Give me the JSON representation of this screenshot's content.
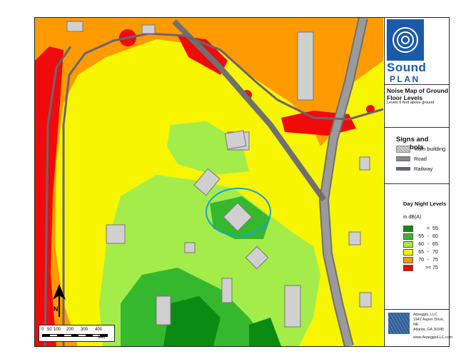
{
  "map": {
    "title": "Noise Map of Ground Floor Levels",
    "subtitle": "Levels 6 feet above ground",
    "scale_labels": [
      "0",
      "50",
      "100",
      "200",
      "300",
      "400"
    ],
    "scale_unit": "feet",
    "north_label": "N"
  },
  "brand": {
    "line1": "Sound",
    "line2": "PLAN"
  },
  "legend": {
    "signs_title": "Signs and symbols",
    "symbols": [
      {
        "label": "Main building",
        "icon": "building-swatch-icon"
      },
      {
        "label": "Road",
        "icon": "road-swatch-icon"
      },
      {
        "label": "Railway",
        "icon": "railway-swatch-icon"
      }
    ],
    "levels_title": "Day Night Levels",
    "levels_unit": "in dB(A)",
    "levels": [
      {
        "color": "#0a8c12",
        "low": "",
        "op": "<",
        "high": "55"
      },
      {
        "color": "#35b82e",
        "low": "55",
        "op": "-",
        "high": "60"
      },
      {
        "color": "#a4ec4a",
        "low": "60",
        "op": "-",
        "high": "65"
      },
      {
        "color": "#f7f500",
        "low": "65",
        "op": "-",
        "high": "70"
      },
      {
        "color": "#ff9b00",
        "low": "70",
        "op": "-",
        "high": "75"
      },
      {
        "color": "#f00a0a",
        "low": "",
        "op": ">=",
        "high": "75"
      }
    ]
  },
  "company": {
    "name": "Arpeggio, LLC",
    "address1": "1947 Aspen Drive, NE",
    "address2": "Atlanta, GA 30345",
    "url": "www.ArpeggioLLC.com"
  }
}
